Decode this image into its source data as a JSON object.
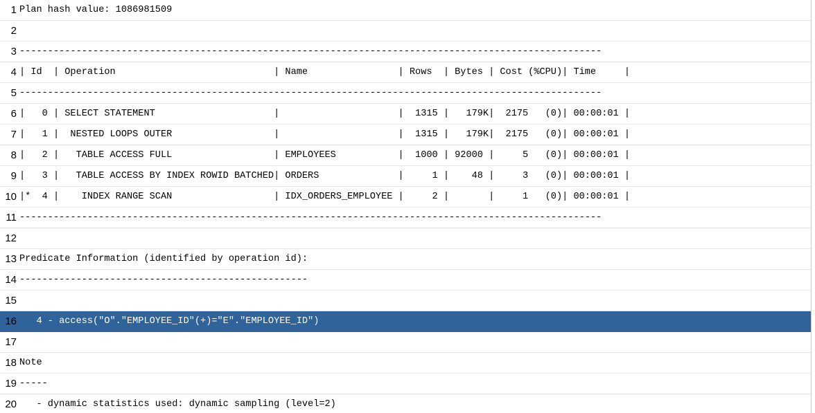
{
  "rows": [
    {
      "num": "1",
      "text": "Plan hash value: 1086981509"
    },
    {
      "num": "2",
      "text": ""
    },
    {
      "num": "3",
      "text": "-------------------------------------------------------------------------------------------------------"
    },
    {
      "num": "4",
      "text": "| Id  | Operation                            | Name                | Rows  | Bytes | Cost (%CPU)| Time     |"
    },
    {
      "num": "5",
      "text": "-------------------------------------------------------------------------------------------------------"
    },
    {
      "num": "6",
      "text": "|   0 | SELECT STATEMENT                     |                     |  1315 |   179K|  2175   (0)| 00:00:01 |"
    },
    {
      "num": "7",
      "text": "|   1 |  NESTED LOOPS OUTER                  |                     |  1315 |   179K|  2175   (0)| 00:00:01 |"
    },
    {
      "num": "8",
      "text": "|   2 |   TABLE ACCESS FULL                  | EMPLOYEES           |  1000 | 92000 |     5   (0)| 00:00:01 |"
    },
    {
      "num": "9",
      "text": "|   3 |   TABLE ACCESS BY INDEX ROWID BATCHED| ORDERS              |     1 |    48 |     3   (0)| 00:00:01 |"
    },
    {
      "num": "10",
      "text": "|*  4 |    INDEX RANGE SCAN                  | IDX_ORDERS_EMPLOYEE |     2 |       |     1   (0)| 00:00:01 |"
    },
    {
      "num": "11",
      "text": "-------------------------------------------------------------------------------------------------------"
    },
    {
      "num": "12",
      "text": ""
    },
    {
      "num": "13",
      "text": "Predicate Information (identified by operation id):"
    },
    {
      "num": "14",
      "text": "---------------------------------------------------"
    },
    {
      "num": "15",
      "text": ""
    },
    {
      "num": "16",
      "text": "   4 - access(\"O\".\"EMPLOYEE_ID\"(+)=\"E\".\"EMPLOYEE_ID\")"
    },
    {
      "num": "17",
      "text": ""
    },
    {
      "num": "18",
      "text": "Note"
    },
    {
      "num": "19",
      "text": "-----"
    },
    {
      "num": "20",
      "text": "   - dynamic statistics used: dynamic sampling (level=2)"
    }
  ],
  "selected_row": "16",
  "colors": {
    "selection_background": "#2f6399",
    "selection_text": "#ffffff"
  }
}
